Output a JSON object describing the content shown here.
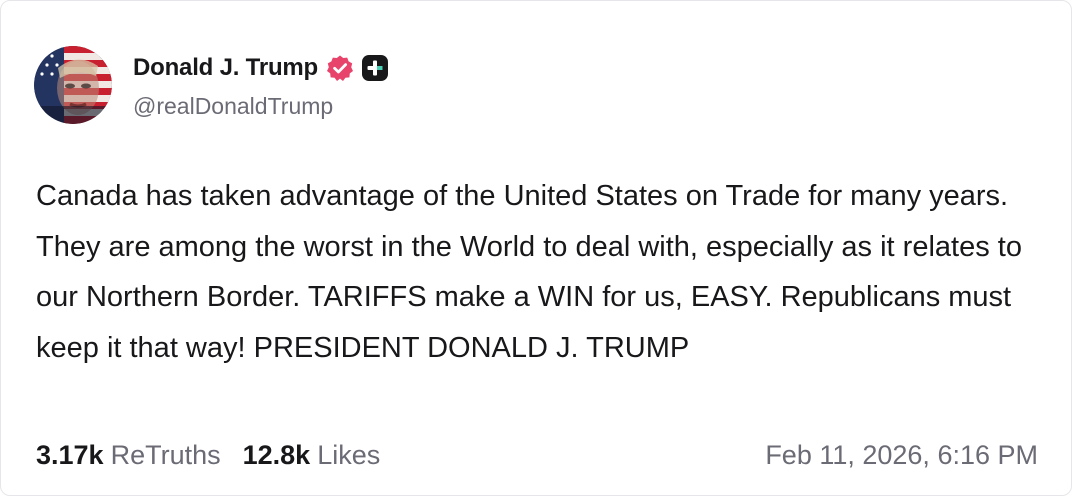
{
  "post": {
    "author": {
      "display_name": "Donald J. Trump",
      "handle": "@realDonaldTrump",
      "verified_icon": "verified-badge-icon",
      "plus_icon": "plus-badge-icon",
      "verified_color": "#e8436b"
    },
    "text": "Canada has taken advantage of the United States on Trade for many years. They are among the worst in the World to deal with, especially as it relates to our Northern Border. TARIFFS make a WIN for us, EASY. Republicans must keep it that way! PRESIDENT DONALD J. TRUMP",
    "stats": {
      "retruths_count": "3.17k",
      "retruths_label": "ReTruths",
      "likes_count": "12.8k",
      "likes_label": "Likes"
    },
    "timestamp": "Feb 11, 2026, 6:16 PM"
  }
}
